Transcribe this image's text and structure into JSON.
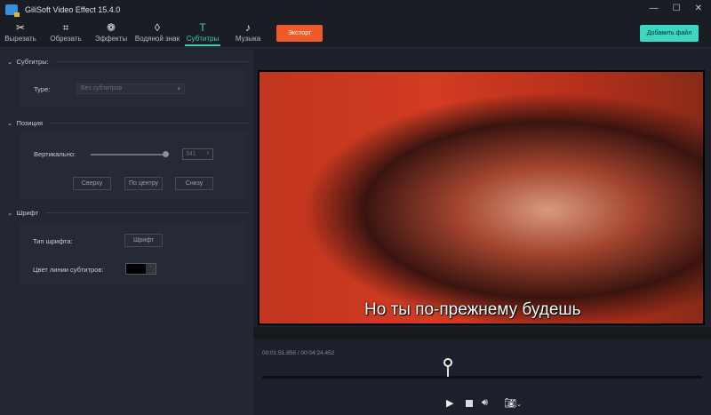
{
  "window": {
    "title": "GiliSoft Video Effect 15.4.0",
    "minimize": "—",
    "maximize": "☐",
    "close": "✕"
  },
  "toolbar": {
    "items": [
      {
        "label": "Вырезать",
        "icon": "✂"
      },
      {
        "label": "Обрезать",
        "icon": "⌗"
      },
      {
        "label": "Эффекты",
        "icon": "❁"
      },
      {
        "label": "Водяной знак",
        "icon": "◊"
      },
      {
        "label": "Субтитры",
        "icon": "T"
      },
      {
        "label": "Музыка",
        "icon": "♪"
      }
    ],
    "export": "Экспорт",
    "add_file": "Добавить файл"
  },
  "panel": {
    "subtitles": {
      "header": "Субтитры:",
      "type_label": "Type:",
      "type_value": "Без субтитров"
    },
    "position": {
      "header": "Позиция",
      "vertical_label": "Вертикально:",
      "vertical_value": "341",
      "slider_fraction": 0.95,
      "top": "Сверху",
      "center": "По центру",
      "bottom": "Снизу"
    },
    "font": {
      "header": "Шрифт",
      "font_type_label": "Тип шрифта:",
      "font_button": "Шрифт",
      "line_color_label": "Цвет линии субтитров:",
      "line_color": "#000000"
    }
  },
  "player": {
    "subtitle": "Но ты по-прежнему будешь",
    "time": "00:01:51.856 / 00:04:24.452",
    "progress": 0.423
  }
}
